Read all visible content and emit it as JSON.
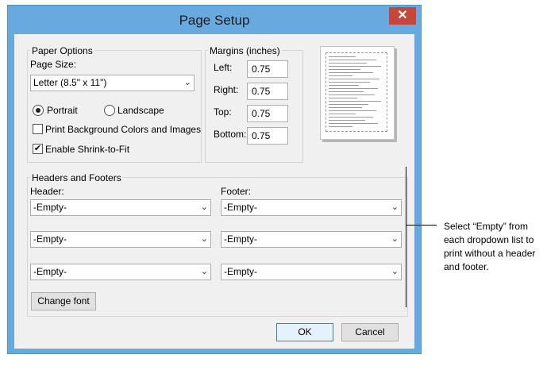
{
  "dialog": {
    "title": "Page Setup",
    "close_glyph": "✕"
  },
  "paper_options": {
    "group_title": "Paper Options",
    "page_size_label": "Page Size:",
    "page_size_value": "Letter (8.5\" x 11\")",
    "portrait_label": "Portrait",
    "landscape_label": "Landscape",
    "orientation_selected": "Portrait",
    "print_background_label": "Print Background Colors and Images",
    "print_background_checked": false,
    "shrink_to_fit_label": "Enable Shrink-to-Fit",
    "shrink_to_fit_checked": true,
    "check_glyph": "✔"
  },
  "margins": {
    "group_title": "Margins (inches)",
    "left_label": "Left:",
    "left_value": "0.75",
    "right_label": "Right:",
    "right_value": "0.75",
    "top_label": "Top:",
    "top_value": "0.75",
    "bottom_label": "Bottom:",
    "bottom_value": "0.75"
  },
  "headers_footers": {
    "group_title": "Headers and Footers",
    "header_label": "Header:",
    "footer_label": "Footer:",
    "header_values": [
      "-Empty-",
      "-Empty-",
      "-Empty-"
    ],
    "footer_values": [
      "-Empty-",
      "-Empty-",
      "-Empty-"
    ],
    "change_font_label": "Change font"
  },
  "buttons": {
    "ok_label": "OK",
    "cancel_label": "Cancel"
  },
  "callout": {
    "text": "Select “Empty” from each dropdown list to print without a header and footer."
  },
  "icons": {
    "dropdown": "chevron-down-icon",
    "close": "close-icon"
  },
  "colors": {
    "title_bar": "#68a9df",
    "close_button": "#c7463b"
  }
}
